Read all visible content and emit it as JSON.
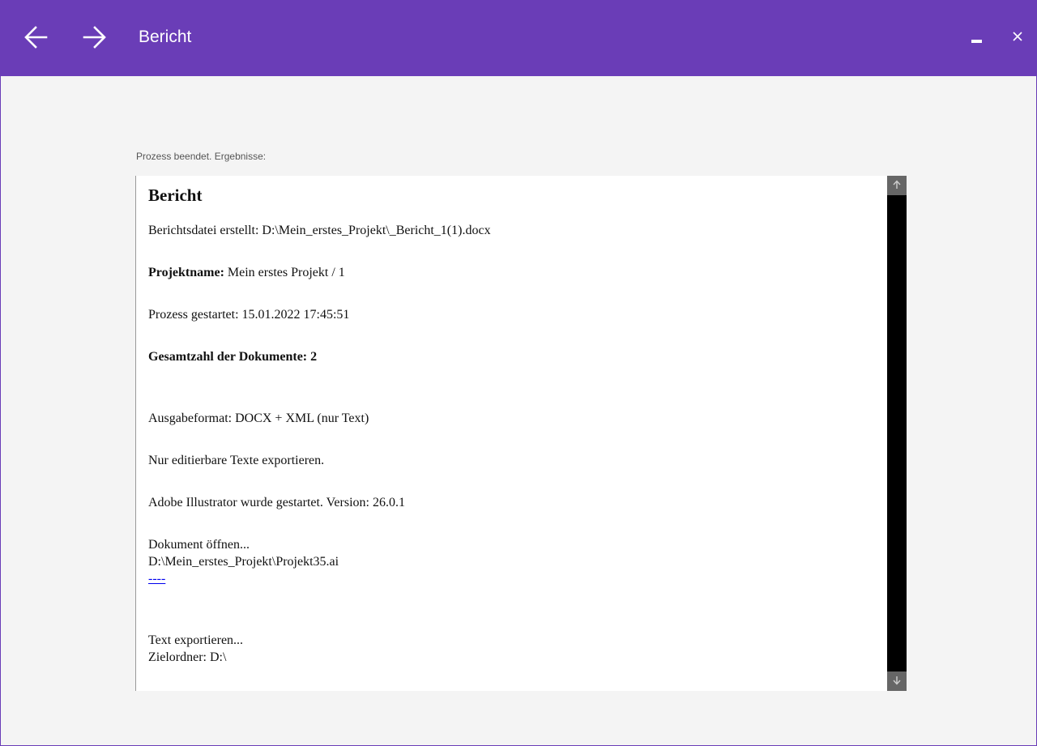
{
  "window": {
    "title": "Bericht",
    "accent_color": "#6a3db7",
    "icons": {
      "back": "arrow-left-icon",
      "forward": "arrow-right-icon",
      "minimize": "minimize-icon",
      "close": "close-icon"
    }
  },
  "main": {
    "status_label": "Prozess beendet. Ergebnisse:"
  },
  "report": {
    "heading": "Bericht",
    "report_file": "Berichtsdatei erstellt: D:\\Mein_erstes_Projekt\\_Bericht_1(1).docx",
    "project_label": "Projektname:",
    "project_value": "Mein erstes Projekt / 1",
    "process_started": "Prozess gestartet: 15.01.2022 17:45:51",
    "total_documents": "Gesamtzahl der Dokumente: 2",
    "output_format": "Ausgabeformat: DOCX + XML (nur Text)",
    "editable_only": "Nur editierbare Texte exportieren.",
    "illustrator_started": "Adobe Illustrator wurde gestartet. Version: 26.0.1",
    "open_document": "Dokument öffnen...",
    "document_path": "D:\\Mein_erstes_Projekt\\Projekt35.ai",
    "separator_link": "----",
    "export_text": "Text exportieren...",
    "target_folder": "Zielordner: D:\\"
  }
}
